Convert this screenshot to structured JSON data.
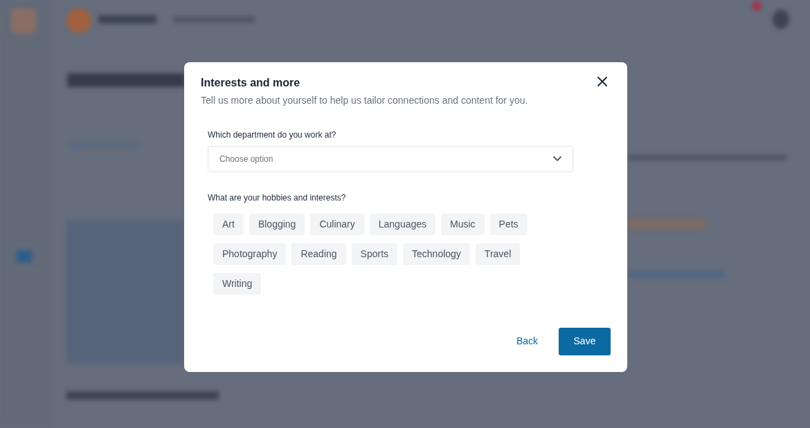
{
  "dialog": {
    "title": "Interests and more",
    "subtitle": "Tell us more about yourself to help us tailor connections and content for you.",
    "department": {
      "label": "Which department do you work at?",
      "placeholder": "Choose option"
    },
    "interests": {
      "label": "What are your hobbies and interests?",
      "options": [
        {
          "label": "Art",
          "selected": false
        },
        {
          "label": "Blogging",
          "selected": false
        },
        {
          "label": "Culinary",
          "selected": false
        },
        {
          "label": "Languages",
          "selected": false
        },
        {
          "label": "Music",
          "selected": false
        },
        {
          "label": "Pets",
          "selected": false
        },
        {
          "label": "Photography",
          "selected": false
        },
        {
          "label": "Reading",
          "selected": false
        },
        {
          "label": "Sports",
          "selected": false
        },
        {
          "label": "Technology",
          "selected": false
        },
        {
          "label": "Travel",
          "selected": false
        },
        {
          "label": "Writing",
          "selected": false
        }
      ]
    },
    "buttons": {
      "back": "Back",
      "save": "Save"
    }
  }
}
